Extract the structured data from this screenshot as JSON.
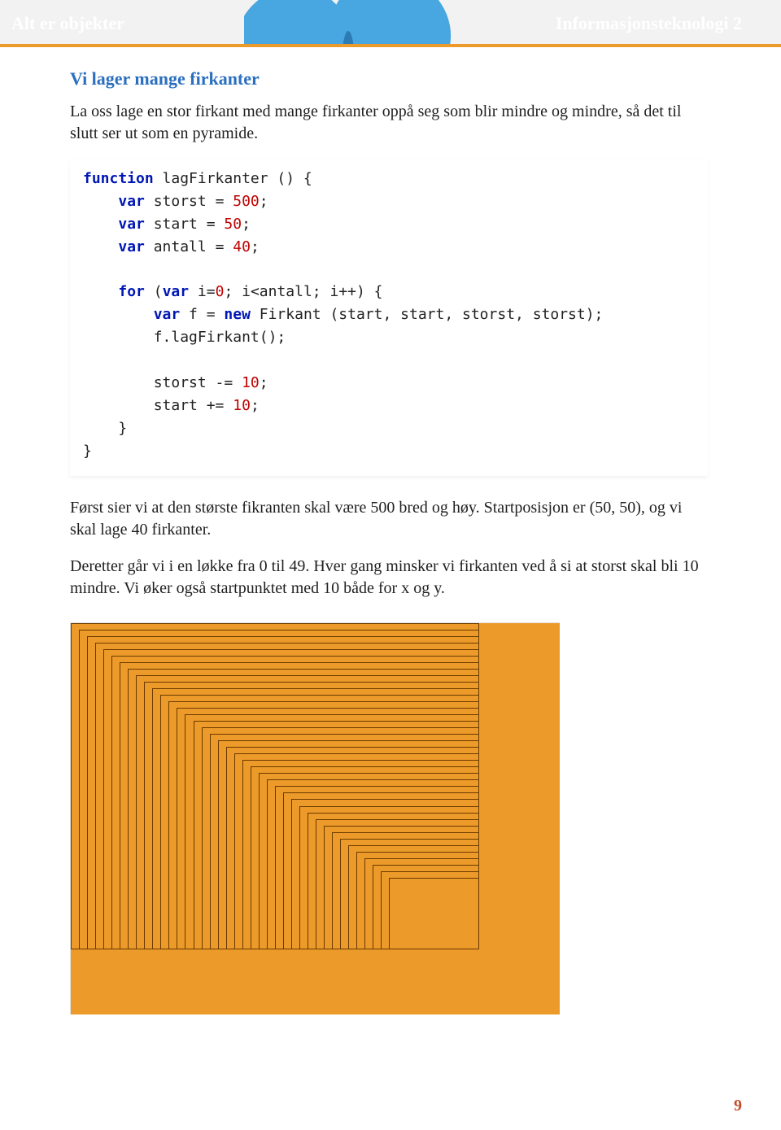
{
  "header": {
    "left": "Alt er objekter",
    "right": "Informasjonsteknologi 2"
  },
  "section_title": "Vi lager mange firkanter",
  "para1": "La oss lage en stor firkant med mange firkanter oppå seg som blir mindre og mindre, så det til slutt ser ut som en pyramide.",
  "code": {
    "l1_kw": "function",
    "l1_name": " lagFirkanter () {",
    "l2_kw": "var",
    "l2_rest": " storst = ",
    "l2_num": "500",
    "l2_end": ";",
    "l3_kw": "var",
    "l3_rest": " start = ",
    "l3_num": "50",
    "l3_end": ";",
    "l4_kw": "var",
    "l4_rest": " antall = ",
    "l4_num": "40",
    "l4_end": ";",
    "l5_kw1": "for",
    "l5_p1": " (",
    "l5_kw2": "var",
    "l5_p2": " i=",
    "l5_n1": "0",
    "l5_p3": "; i<antall; i++) {",
    "l6_kw": "var",
    "l6_p1": " f = ",
    "l6_kw2": "new",
    "l6_p2": " Firkant (start, start, storst, storst);",
    "l7": "f.lagFirkant();",
    "l8_p1": "storst -= ",
    "l8_num": "10",
    "l8_end": ";",
    "l9_p1": "start += ",
    "l9_num": "10",
    "l9_end": ";",
    "l10": "}",
    "l11": "}"
  },
  "para2": "Først sier vi at den største fikranten skal være 500 bred og høy. Startposisjon er (50, 50), og vi skal lage 40 firkanter.",
  "para3": "Deretter går vi i en løkke fra 0 til 49. Hver gang minsker vi firkanten ved å si at storst skal bli 10 mindre. Vi øker også startpunktet med 10 både for x og y.",
  "squares": {
    "count": 40,
    "start": 50,
    "storst": 500,
    "step_shrink": 10,
    "step_offset": 10
  },
  "page_number": "9"
}
